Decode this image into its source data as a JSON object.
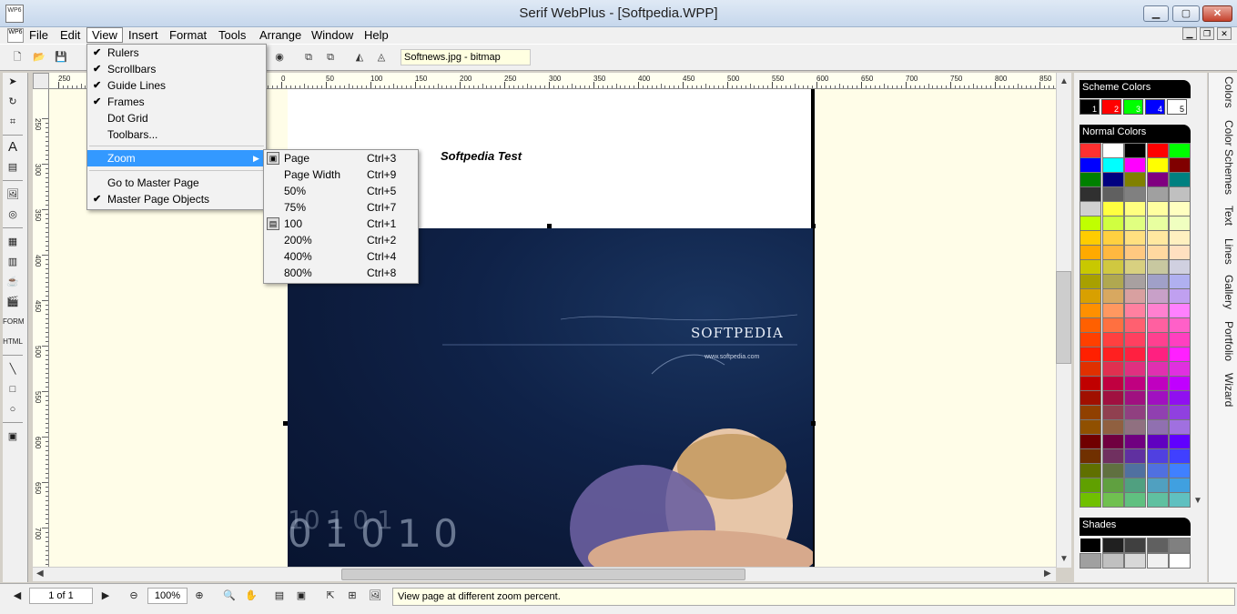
{
  "window": {
    "title": "Serif WebPlus  - [Softpedia.WPP]",
    "min": "▁",
    "max": "▢",
    "close": "✕"
  },
  "menubar": [
    "File",
    "Edit",
    "View",
    "Insert",
    "Format",
    "Tools",
    "Arrange",
    "Window",
    "Help"
  ],
  "toolbar": {
    "object_info": "Softnews.jpg - bitmap"
  },
  "ruler_top": [
    "250",
    "200",
    "150",
    "100",
    "50",
    "0",
    "50",
    "100",
    "150",
    "200",
    "250",
    "300",
    "350",
    "400",
    "450",
    "500",
    "550",
    "600",
    "650",
    "700",
    "750",
    "800",
    "850",
    "900"
  ],
  "ruler_left": [
    "250",
    "300",
    "350",
    "400",
    "450",
    "500",
    "550",
    "600",
    "650",
    "700"
  ],
  "page": {
    "caption": "Softpedia Test",
    "logo": "SOFTPEDIA",
    "logo_url": "www.softpedia.com",
    "watermark": "SOFTPEDIA"
  },
  "view_menu": {
    "items": [
      {
        "label": "Rulers",
        "checked": true
      },
      {
        "label": "Scrollbars",
        "checked": true
      },
      {
        "label": "Guide Lines",
        "checked": true
      },
      {
        "label": "Frames",
        "checked": true
      },
      {
        "label": "Dot Grid",
        "checked": false
      },
      {
        "label": "Toolbars...",
        "checked": false
      }
    ],
    "zoom": "Zoom",
    "go_master": "Go to Master Page",
    "master_objects": "Master Page Objects",
    "check": "✔",
    "sub": "▶"
  },
  "zoom_menu": [
    {
      "label": "Page",
      "shortcut": "Ctrl+3"
    },
    {
      "label": "Page Width",
      "shortcut": "Ctrl+9"
    },
    {
      "label": "50%",
      "shortcut": "Ctrl+5"
    },
    {
      "label": "75%",
      "shortcut": "Ctrl+7"
    },
    {
      "label": "100",
      "shortcut": "Ctrl+1"
    },
    {
      "label": "200%",
      "shortcut": "Ctrl+2"
    },
    {
      "label": "400%",
      "shortcut": "Ctrl+4"
    },
    {
      "label": "800%",
      "shortcut": "Ctrl+8"
    }
  ],
  "status": {
    "page": "1 of 1",
    "zoom": "100%",
    "hint": "View page at different zoom percent."
  },
  "panel": {
    "scheme_title": "Scheme Colors",
    "scheme_numbers": [
      "1",
      "2",
      "3",
      "4",
      "5"
    ],
    "scheme_colors": [
      "#000000",
      "#ff0000",
      "#00ff00",
      "#0000ff",
      "#ffffff"
    ],
    "normal_title": "Normal Colors",
    "shades_title": "Shades"
  },
  "tabs": [
    "Colors",
    "Color Schemes",
    "Text",
    "Lines",
    "Gallery",
    "Portfolio",
    "Wizard"
  ],
  "normal_colors": [
    [
      "#ff3030",
      "#ffffff",
      "#000000",
      "#ff0000",
      "#00ff00"
    ],
    [
      "#0000ff",
      "#00ffff",
      "#ff00ff",
      "#ffff00",
      "#800000"
    ],
    [
      "#008000",
      "#000080",
      "#808000",
      "#800080",
      "#008080"
    ],
    [
      "#303030",
      "#606060",
      "#808080",
      "#a0a0a0",
      "#c0c0c0"
    ],
    [
      "#d0d0d0",
      "#ffff40",
      "#ffff80",
      "#ffffa0",
      "#ffffc0"
    ],
    [
      "#c0ff00",
      "#d0ff40",
      "#e0ff80",
      "#e8ffa0",
      "#f0ffc0"
    ],
    [
      "#ffcc00",
      "#ffd040",
      "#ffe080",
      "#ffe8a0",
      "#fff0c0"
    ],
    [
      "#ffaa00",
      "#ffb840",
      "#ffc880",
      "#ffd8a0",
      "#ffe0c0"
    ],
    [
      "#c8c800",
      "#d0c840",
      "#d8d080",
      "#c8c8a0",
      "#d0d0e0"
    ],
    [
      "#a8a000",
      "#b0a850",
      "#a8a0a0",
      "#a0a0c8",
      "#b0b0f0"
    ],
    [
      "#d8a000",
      "#d8a860",
      "#d8a0a0",
      "#c8a0c8",
      "#c0a0f0"
    ],
    [
      "#ff9000",
      "#ff9860",
      "#ff80a0",
      "#ff80d0",
      "#ff80ff"
    ],
    [
      "#ff6000",
      "#ff7040",
      "#ff6070",
      "#ff60a0",
      "#ff60c8"
    ],
    [
      "#ff4000",
      "#ff4040",
      "#ff4060",
      "#ff4090",
      "#ff40c0"
    ],
    [
      "#ff2000",
      "#ff2020",
      "#ff2040",
      "#ff2080",
      "#ff20ff"
    ],
    [
      "#e03000",
      "#e03050",
      "#e03080",
      "#e030b0",
      "#e030e0"
    ],
    [
      "#c00000",
      "#c00040",
      "#c00080",
      "#c000c0",
      "#c000ff"
    ],
    [
      "#a01000",
      "#a01040",
      "#a01080",
      "#a010c0",
      "#9010f0"
    ],
    [
      "#904000",
      "#904050",
      "#904080",
      "#9040b0",
      "#9040e0"
    ],
    [
      "#905000",
      "#906040",
      "#907080",
      "#9070b0",
      "#a070e0"
    ],
    [
      "#700000",
      "#700040",
      "#700080",
      "#6000c0",
      "#6000ff"
    ],
    [
      "#703000",
      "#703060",
      "#6030a0",
      "#5040e0",
      "#4040ff"
    ],
    [
      "#607000",
      "#607040",
      "#5070a0",
      "#5070e0",
      "#4080ff"
    ],
    [
      "#60a000",
      "#60a040",
      "#50a080",
      "#50a0c0",
      "#40a0e0"
    ],
    [
      "#70c000",
      "#70c050",
      "#60c080",
      "#60c0a0",
      "#60c0c0"
    ]
  ],
  "shades": [
    "#000000",
    "#202020",
    "#404040",
    "#606060",
    "#808080",
    "#a0a0a0",
    "#c0c0c0",
    "#d8d8d8",
    "#f0f0f0",
    "#ffffff"
  ]
}
